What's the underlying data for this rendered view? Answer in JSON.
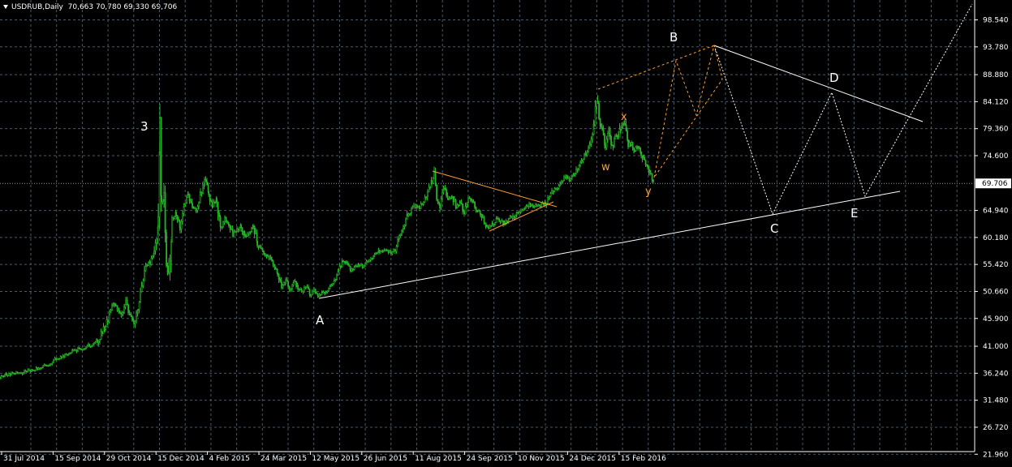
{
  "window": {
    "symbol_header": "USDRUB,Daily",
    "ohlc_header": "70,663 70,780 69,330 69,706"
  },
  "colors": {
    "background": "#000000",
    "grid": "#4a5a68",
    "candles": "#26b326",
    "axis_text": "#ffffff",
    "trendlines": "#ffffff",
    "triangle": "#ff9d2e",
    "bid_line": "#8a9aa8"
  },
  "chart_data": {
    "type": "candlestick",
    "x_tick_labels": [
      "31 Jul 2014",
      "15 Sep 2014",
      "29 Oct 2014",
      "15 Dec 2014",
      "4 Feb 2015",
      "24 Mar 2015",
      "12 May 2015",
      "26 Jun 2015",
      "11 Aug 2015",
      "24 Sep 2015",
      "10 Nov 2015",
      "24 Dec 2015",
      "15 Feb 2016"
    ],
    "y_tick_labels": [
      "98.540",
      "93.780",
      "88.880",
      "84.120",
      "79.360",
      "74.600",
      "69.706",
      "64.940",
      "60.180",
      "55.420",
      "50.660",
      "45.900",
      "41.000",
      "36.240",
      "31.480",
      "26.720",
      "21.960"
    ],
    "y_ticks": [
      98.54,
      93.78,
      88.88,
      84.12,
      79.36,
      74.6,
      64.94,
      60.18,
      55.42,
      50.66,
      45.9,
      41.0,
      36.24,
      31.48,
      26.72,
      21.96
    ],
    "current_price": 69.706,
    "current_price_label": "69.706",
    "ylim": [
      21.0,
      100.0
    ],
    "close_path": [
      [
        0,
        35.6
      ],
      [
        8,
        36.0
      ],
      [
        20,
        36.3
      ],
      [
        30,
        36.4
      ],
      [
        40,
        36.7
      ],
      [
        50,
        37.3
      ],
      [
        60,
        37.9
      ],
      [
        70,
        38.9
      ],
      [
        80,
        39.4
      ],
      [
        90,
        40.1
      ],
      [
        100,
        40.6
      ],
      [
        110,
        41.2
      ],
      [
        120,
        41.9
      ],
      [
        130,
        44.5
      ],
      [
        135,
        46.8
      ],
      [
        140,
        48.6
      ],
      [
        145,
        47.5
      ],
      [
        150,
        46.2
      ],
      [
        155,
        48.7
      ],
      [
        160,
        46.3
      ],
      [
        165,
        45.0
      ],
      [
        170,
        48.2
      ],
      [
        175,
        51.5
      ],
      [
        180,
        55.0
      ],
      [
        185,
        55.8
      ],
      [
        190,
        57.6
      ],
      [
        195,
        63.0
      ],
      [
        197,
        79.8
      ],
      [
        199,
        66.5
      ],
      [
        202,
        68.0
      ],
      [
        205,
        55.0
      ],
      [
        208,
        52.0
      ],
      [
        212,
        63.5
      ],
      [
        217,
        64.5
      ],
      [
        222,
        62.0
      ],
      [
        227,
        66.0
      ],
      [
        232,
        67.5
      ],
      [
        237,
        65.5
      ],
      [
        242,
        65.0
      ],
      [
        247,
        67.5
      ],
      [
        252,
        70.2
      ],
      [
        257,
        68.0
      ],
      [
        262,
        65.5
      ],
      [
        267,
        67.0
      ],
      [
        272,
        62.0
      ],
      [
        277,
        63.5
      ],
      [
        282,
        62.5
      ],
      [
        287,
        60.5
      ],
      [
        292,
        61.5
      ],
      [
        297,
        62.5
      ],
      [
        302,
        60.0
      ],
      [
        307,
        61.2
      ],
      [
        312,
        62.3
      ],
      [
        317,
        59.0
      ],
      [
        322,
        58.0
      ],
      [
        327,
        57.0
      ],
      [
        332,
        56.5
      ],
      [
        337,
        55.0
      ],
      [
        342,
        54.0
      ],
      [
        347,
        51.5
      ],
      [
        352,
        52.5
      ],
      [
        357,
        51.0
      ],
      [
        362,
        52.5
      ],
      [
        367,
        51.3
      ],
      [
        372,
        50.5
      ],
      [
        377,
        51.5
      ],
      [
        382,
        50.2
      ],
      [
        387,
        50.8
      ],
      [
        392,
        50.0
      ],
      [
        397,
        50.4
      ],
      [
        402,
        50.5
      ],
      [
        407,
        51.5
      ],
      [
        412,
        52.5
      ],
      [
        417,
        54.0
      ],
      [
        422,
        56.0
      ],
      [
        427,
        55.5
      ],
      [
        432,
        54.5
      ],
      [
        437,
        55.0
      ],
      [
        442,
        55.5
      ],
      [
        447,
        54.8
      ],
      [
        452,
        55.8
      ],
      [
        457,
        56.5
      ],
      [
        462,
        57.4
      ],
      [
        467,
        57.8
      ],
      [
        472,
        57.5
      ],
      [
        477,
        57.8
      ],
      [
        482,
        57.6
      ],
      [
        487,
        58.0
      ],
      [
        492,
        60.5
      ],
      [
        497,
        62.0
      ],
      [
        502,
        64.0
      ],
      [
        507,
        65.0
      ],
      [
        512,
        66.0
      ],
      [
        517,
        65.5
      ],
      [
        522,
        66.5
      ],
      [
        527,
        68.0
      ],
      [
        532,
        70.0
      ],
      [
        535,
        70.8
      ],
      [
        538,
        67.0
      ],
      [
        542,
        66.0
      ],
      [
        547,
        69.0
      ],
      [
        552,
        66.5
      ],
      [
        557,
        67.5
      ],
      [
        562,
        65.5
      ],
      [
        567,
        66.5
      ],
      [
        572,
        64.5
      ],
      [
        577,
        67.0
      ],
      [
        582,
        66.5
      ],
      [
        587,
        65.0
      ],
      [
        592,
        64.5
      ],
      [
        597,
        62.5
      ],
      [
        602,
        61.8
      ],
      [
        607,
        62.5
      ],
      [
        612,
        63.3
      ],
      [
        617,
        63.0
      ],
      [
        622,
        62.5
      ],
      [
        627,
        63.8
      ],
      [
        632,
        63.5
      ],
      [
        637,
        65.0
      ],
      [
        642,
        64.8
      ],
      [
        647,
        65.2
      ],
      [
        652,
        66.0
      ],
      [
        657,
        65.5
      ],
      [
        662,
        66.0
      ],
      [
        667,
        65.8
      ],
      [
        672,
        66.2
      ],
      [
        677,
        67.5
      ],
      [
        682,
        68.5
      ],
      [
        687,
        69.0
      ],
      [
        692,
        70.3
      ],
      [
        697,
        71.0
      ],
      [
        702,
        70.0
      ],
      [
        707,
        71.0
      ],
      [
        712,
        72.5
      ],
      [
        717,
        74.0
      ],
      [
        722,
        74.8
      ],
      [
        727,
        76.5
      ],
      [
        732,
        80.0
      ],
      [
        735,
        85.0
      ],
      [
        738,
        81.0
      ],
      [
        742,
        79.0
      ],
      [
        746,
        76.0
      ],
      [
        750,
        79.5
      ],
      [
        754,
        76.0
      ],
      [
        758,
        78.0
      ],
      [
        762,
        77.0
      ],
      [
        766,
        80.8
      ],
      [
        770,
        79.5
      ],
      [
        774,
        76.5
      ],
      [
        778,
        77.0
      ],
      [
        782,
        75.5
      ],
      [
        786,
        76.5
      ],
      [
        790,
        75.0
      ],
      [
        794,
        73.5
      ],
      [
        798,
        73.2
      ],
      [
        802,
        71.0
      ],
      [
        806,
        69.7
      ]
    ],
    "wave_labels": [
      {
        "text": "3",
        "color": "#ffffff"
      },
      {
        "text": "A",
        "color": "#ffffff"
      },
      {
        "text": "B",
        "color": "#ffffff"
      },
      {
        "text": "C",
        "color": "#ffffff"
      },
      {
        "text": "D",
        "color": "#ffffff"
      },
      {
        "text": "E",
        "color": "#ffffff"
      },
      {
        "text": "w",
        "color": "#ff9d2e"
      },
      {
        "text": "x",
        "color": "#ff9d2e"
      },
      {
        "text": "y",
        "color": "#ff9d2e"
      }
    ]
  }
}
